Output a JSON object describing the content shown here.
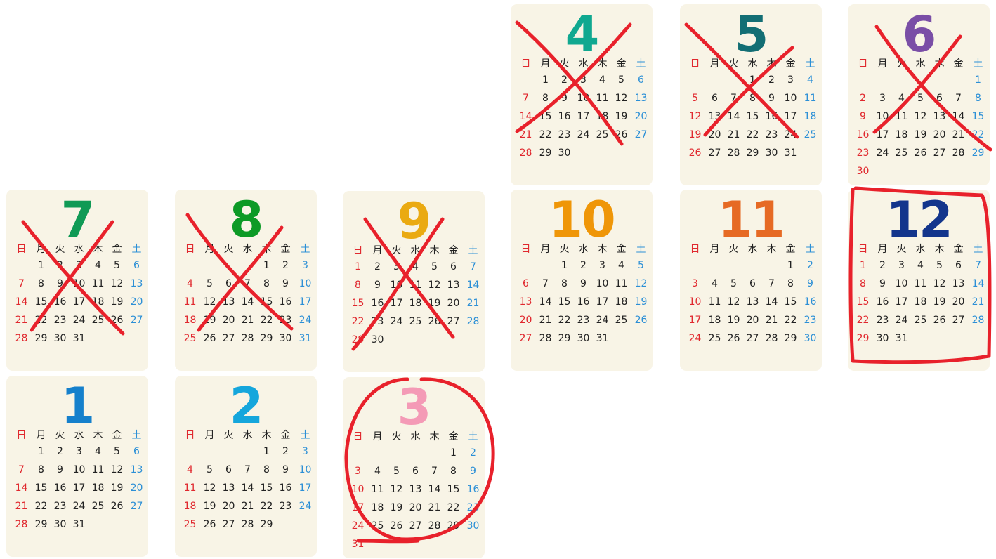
{
  "weekdays": [
    "日",
    "月",
    "火",
    "水",
    "木",
    "金",
    "土"
  ],
  "months": [
    {
      "label": "4",
      "color": "#10a890",
      "start": 1,
      "days": 30,
      "mark": "cross"
    },
    {
      "label": "5",
      "color": "#136e74",
      "start": 3,
      "days": 31,
      "mark": "cross"
    },
    {
      "label": "6",
      "color": "#7a4ea6",
      "start": 6,
      "days": 30,
      "mark": "cross"
    },
    {
      "label": "7",
      "color": "#109a55",
      "start": 1,
      "days": 31,
      "mark": "cross"
    },
    {
      "label": "8",
      "color": "#0d9a26",
      "start": 4,
      "days": 31,
      "mark": "cross"
    },
    {
      "label": "9",
      "color": "#eaaa12",
      "start": 0,
      "days": 30,
      "mark": "cross"
    },
    {
      "label": "10",
      "color": "#ef9608",
      "start": 2,
      "days": 31,
      "mark": "none"
    },
    {
      "label": "11",
      "color": "#e66a24",
      "start": 5,
      "days": 30,
      "mark": "none"
    },
    {
      "label": "12",
      "color": "#13358c",
      "start": 0,
      "days": 31,
      "mark": "box"
    },
    {
      "label": "1",
      "color": "#1580cc",
      "start": 1,
      "days": 31,
      "mark": "none"
    },
    {
      "label": "2",
      "color": "#15a6dc",
      "start": 4,
      "days": 29,
      "mark": "none"
    },
    {
      "label": "3",
      "color": "#f49ab6",
      "start": 5,
      "days": 31,
      "mark": "circle"
    }
  ]
}
